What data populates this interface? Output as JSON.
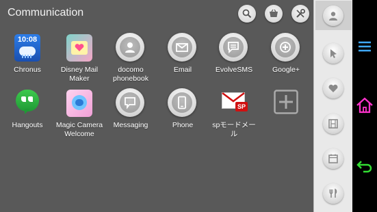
{
  "header": {
    "title": "Communication"
  },
  "header_buttons": [
    {
      "name": "search-button",
      "icon": "search-icon"
    },
    {
      "name": "store-button",
      "icon": "basket-icon"
    },
    {
      "name": "tools-button",
      "icon": "tools-icon"
    }
  ],
  "apps": [
    {
      "label": "Chronus"
    },
    {
      "label": "Disney Mail Maker"
    },
    {
      "label": "docomo phonebook"
    },
    {
      "label": "Email"
    },
    {
      "label": "EvolveSMS"
    },
    {
      "label": "Google+"
    },
    {
      "label": "Hangouts"
    },
    {
      "label": "Magic Camera Welcome"
    },
    {
      "label": "Messaging"
    },
    {
      "label": "Phone"
    },
    {
      "label": "spモードメール"
    }
  ],
  "chronus_time": "10:08",
  "sp_badge": "SP",
  "sidebar_tabs": [
    "person-icon",
    "cursor-icon",
    "heart-icon",
    "film-icon",
    "calendar-icon",
    "fork-knife-icon"
  ],
  "nav": [
    "menu-icon",
    "home-icon",
    "back-icon"
  ],
  "colors": {
    "nav_menu": "#3fa9ff",
    "nav_home": "#ff33cc",
    "nav_back": "#33dd33",
    "background": "#595959",
    "sidebar": "#e9e9e9"
  }
}
